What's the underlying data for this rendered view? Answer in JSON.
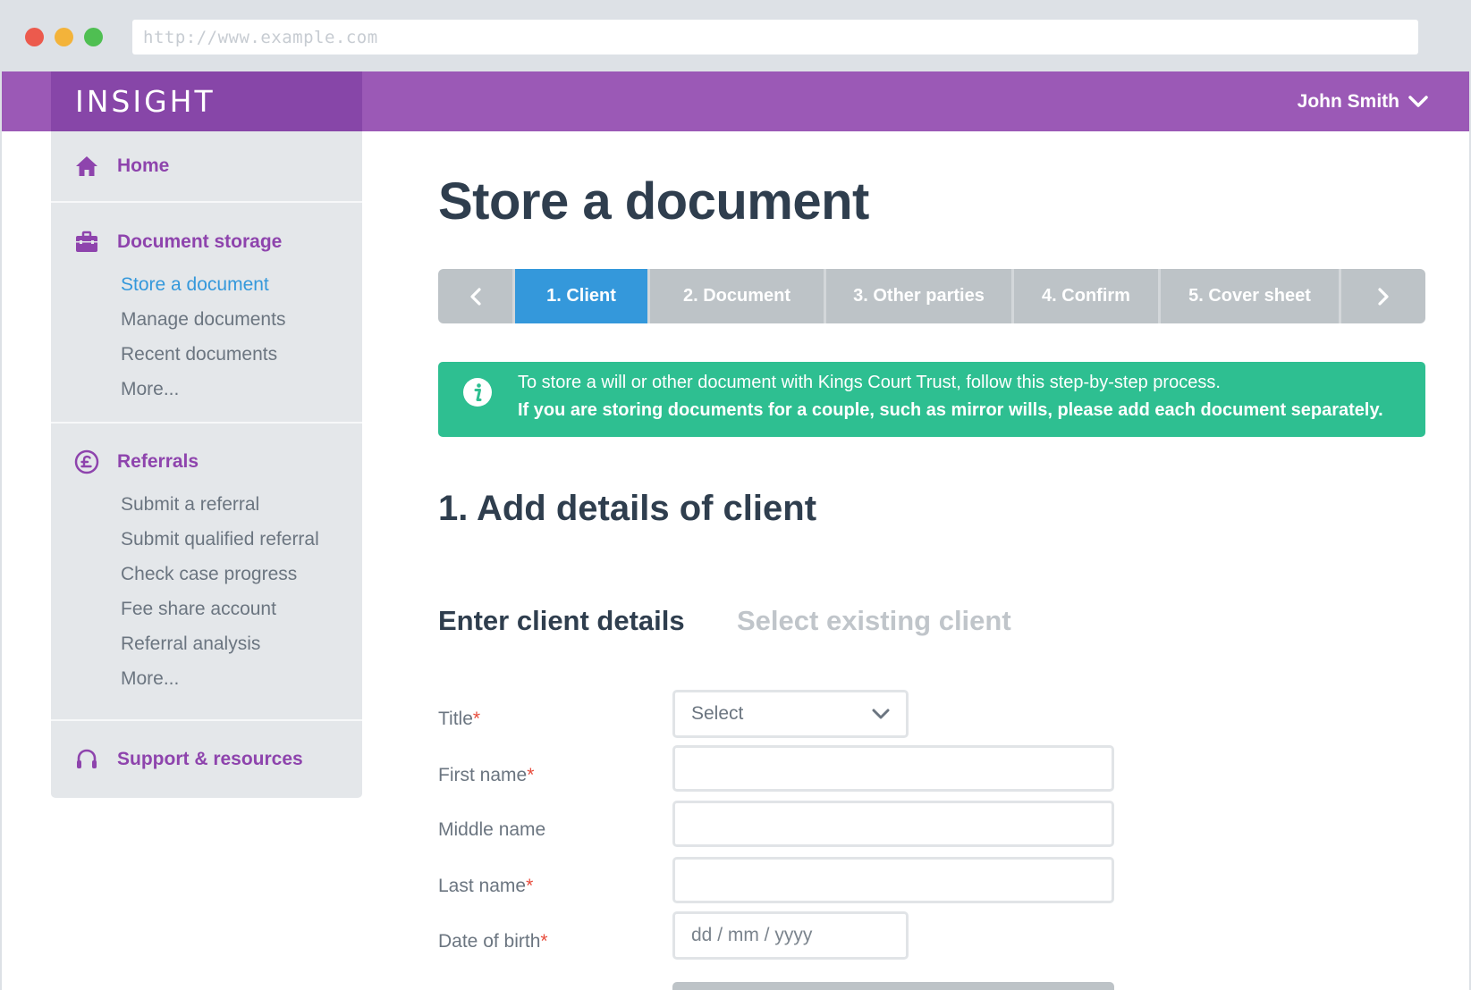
{
  "browser": {
    "url": "http://www.example.com"
  },
  "header": {
    "brand": "INSIGHT",
    "user_name": "John Smith"
  },
  "sidebar": {
    "home": {
      "label": "Home"
    },
    "document_storage": {
      "label": "Document storage",
      "items": [
        {
          "label": "Store a document",
          "active": true
        },
        {
          "label": "Manage documents"
        },
        {
          "label": "Recent documents"
        },
        {
          "label": "More..."
        }
      ]
    },
    "referrals": {
      "label": "Referrals",
      "items": [
        {
          "label": "Submit a referral"
        },
        {
          "label": "Submit qualified referral"
        },
        {
          "label": "Check case progress"
        },
        {
          "label": "Fee share account"
        },
        {
          "label": "Referral analysis"
        },
        {
          "label": "More..."
        }
      ]
    },
    "support": {
      "label": "Support & resources"
    }
  },
  "main": {
    "title": "Store a document",
    "steps": [
      {
        "label": "1. Client",
        "active": true
      },
      {
        "label": "2. Document"
      },
      {
        "label": "3. Other parties"
      },
      {
        "label": "4. Confirm"
      },
      {
        "label": "5. Cover sheet"
      }
    ],
    "alert": {
      "line1": "To store a will or other document with Kings Court Trust, follow this step-by-step process.",
      "line2": "If you are storing documents for a couple, such as mirror wills, please add each document separately."
    },
    "section_title": "1. Add details of client",
    "tabs": {
      "active": "Enter client details",
      "inactive": "Select existing client"
    },
    "form": {
      "title_label": "Title",
      "title_value": "Select",
      "first_name_label": "First name",
      "middle_name_label": "Middle name",
      "last_name_label": "Last name",
      "dob_label": "Date of birth",
      "dob_placeholder": "dd / mm / yyyy",
      "required_marker": "*"
    }
  },
  "colors": {
    "brand_purple": "#9b59b6",
    "brand_purple_dark": "#8746a8",
    "link_purple": "#8e44ad",
    "active_blue": "#3498db",
    "alert_green": "#2ebf91",
    "required_red": "#e74c3c"
  },
  "icons": {
    "home": "home-icon",
    "document_storage": "briefcase-icon",
    "referrals": "pound-coin-icon",
    "support": "headset-icon",
    "user_menu": "chevron-down-icon",
    "alert": "info-icon"
  }
}
